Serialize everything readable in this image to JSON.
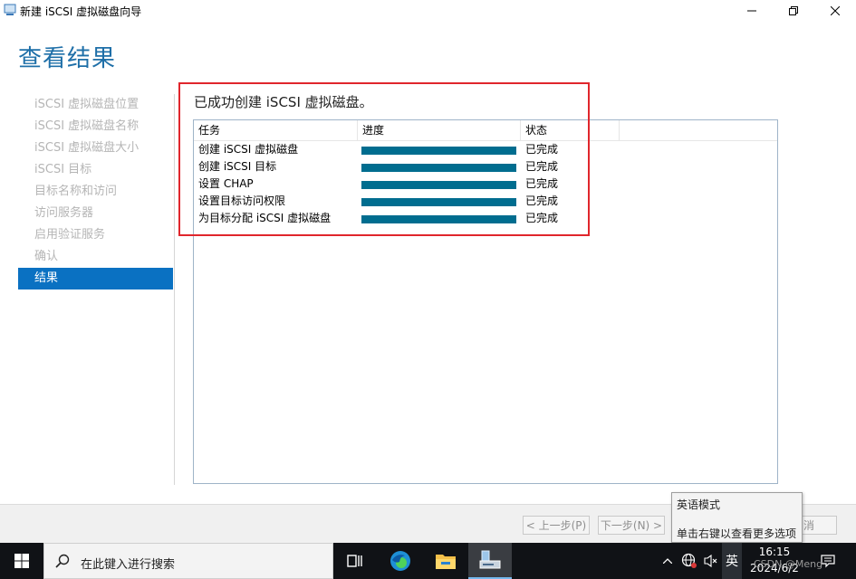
{
  "window": {
    "title": "新建 iSCSI 虚拟磁盘向导",
    "heading": "查看结果"
  },
  "nav": {
    "items": [
      {
        "label": "iSCSI 虚拟磁盘位置"
      },
      {
        "label": "iSCSI 虚拟磁盘名称"
      },
      {
        "label": "iSCSI 虚拟磁盘大小"
      },
      {
        "label": "iSCSI 目标"
      },
      {
        "label": "目标名称和访问"
      },
      {
        "label": "访问服务器"
      },
      {
        "label": "启用验证服务"
      },
      {
        "label": "确认"
      },
      {
        "label": "结果"
      }
    ],
    "active_index": 8
  },
  "result": {
    "message": "已成功创建 iSCSI 虚拟磁盘。",
    "columns": [
      "任务",
      "进度",
      "状态"
    ],
    "rows": [
      {
        "task": "创建 iSCSI 虚拟磁盘",
        "progress": 1.0,
        "status": "已完成"
      },
      {
        "task": "创建 iSCSI 目标",
        "progress": 1.0,
        "status": "已完成"
      },
      {
        "task": "设置 CHAP",
        "progress": 1.0,
        "status": "已完成"
      },
      {
        "task": "设置目标访问权限",
        "progress": 1.0,
        "status": "已完成"
      },
      {
        "task": "为目标分配 iSCSI 虚拟磁盘",
        "progress": 1.0,
        "status": "已完成"
      }
    ]
  },
  "footer": {
    "prev_label": "< 上一步(P)",
    "next_label": "下一步(N) >",
    "cancel_partial": "消"
  },
  "tooltip": {
    "line1": "英语模式",
    "line2": "单击右键以查看更多选项"
  },
  "taskbar": {
    "search_placeholder": "在此键入进行搜索",
    "ime_label": "英",
    "time": "16:15",
    "date": "2024/6/2",
    "watermark": "CSDN @Meng"
  },
  "colors": {
    "accent": "#0a71c2",
    "progress": "#006d8f",
    "heading": "#1e6fa8",
    "highlight": "#e0262c"
  }
}
